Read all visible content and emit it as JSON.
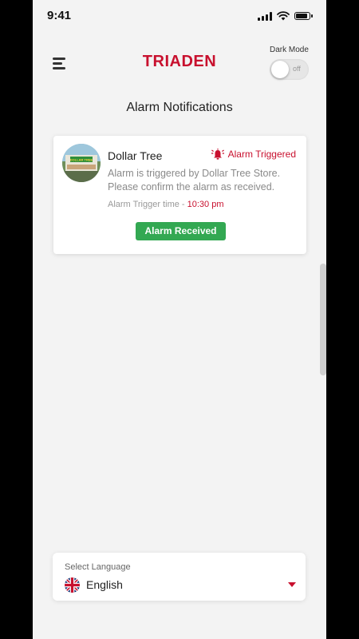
{
  "status_bar": {
    "time": "9:41"
  },
  "header": {
    "brand": "TRIADEN",
    "dark_mode_label": "Dark Mode",
    "dark_mode_state": "off"
  },
  "page": {
    "title": "Alarm Notifications"
  },
  "notification": {
    "store_name": "Dollar Tree",
    "alarm_status": "Alarm Triggered",
    "message": "Alarm is triggered by Dollar Tree Store. Please confirm the alarm as received.",
    "trigger_label": "Alarm Trigger time - ",
    "trigger_time": "10:30 pm",
    "action_label": "Alarm Received",
    "avatar_sign_text": "DOLLAR TREE"
  },
  "language": {
    "label": "Select Language",
    "value": "English",
    "flag": "uk-flag-icon"
  },
  "colors": {
    "brand": "#c8102e",
    "accent_green": "#33a852",
    "background": "#f3f3f3"
  }
}
